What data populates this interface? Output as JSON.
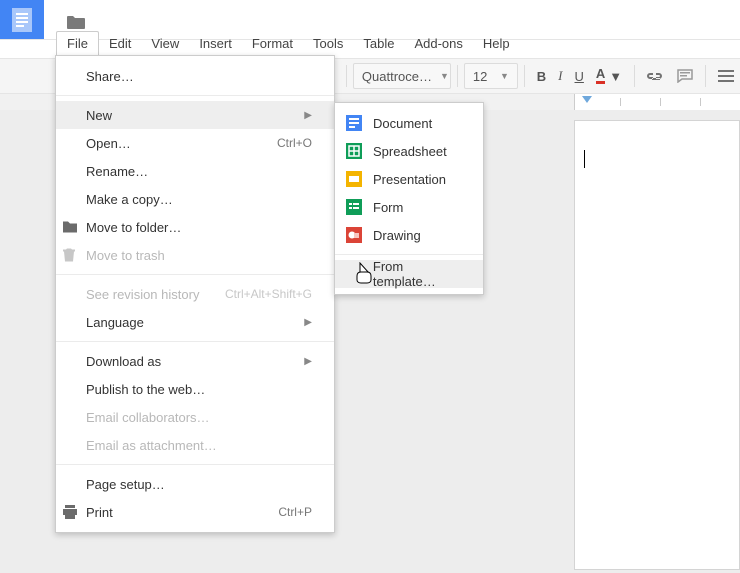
{
  "menubar": {
    "file": "File",
    "edit": "Edit",
    "view": "View",
    "insert": "Insert",
    "format": "Format",
    "tools": "Tools",
    "table": "Table",
    "addons": "Add-ons",
    "help": "Help"
  },
  "toolbar": {
    "font_name": "Quattroce…",
    "font_size": "12",
    "bold": "B",
    "italic": "I",
    "underline": "U",
    "text_color": "A"
  },
  "file_menu": {
    "share": "Share…",
    "new": "New",
    "open": "Open…",
    "open_shortcut": "Ctrl+O",
    "rename": "Rename…",
    "make_a_copy": "Make a copy…",
    "move_to_folder": "Move to folder…",
    "move_to_trash": "Move to trash",
    "see_revision_history": "See revision history",
    "see_revision_history_shortcut": "Ctrl+Alt+Shift+G",
    "language": "Language",
    "download_as": "Download as",
    "publish_to_web": "Publish to the web…",
    "email_collaborators": "Email collaborators…",
    "email_as_attachment": "Email as attachment…",
    "page_setup": "Page setup…",
    "print": "Print",
    "print_shortcut": "Ctrl+P"
  },
  "new_submenu": {
    "document": "Document",
    "spreadsheet": "Spreadsheet",
    "presentation": "Presentation",
    "form": "Form",
    "drawing": "Drawing",
    "from_template": "From template…"
  },
  "colors": {
    "brand_blue": "#4285f4",
    "sheets_green": "#0f9d58",
    "slides_yellow": "#f4b400",
    "forms_green": "#0f9d58",
    "drawing_red": "#db4437"
  }
}
